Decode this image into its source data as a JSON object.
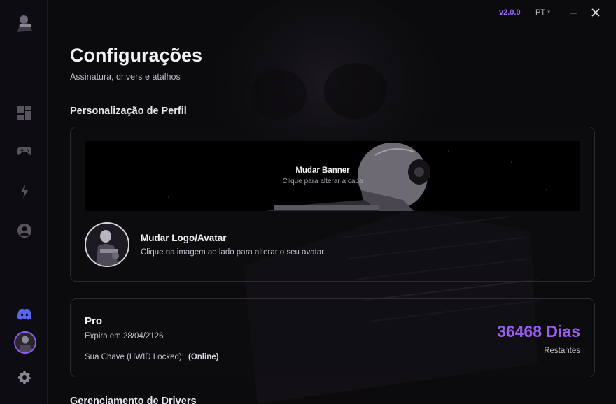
{
  "app": {
    "version": "v2.0.0",
    "language": "PT"
  },
  "colors": {
    "accent": "#9b5cf6",
    "background": "#0b0a0d",
    "discord": "#5865f2"
  },
  "sidebar": {
    "items": [
      {
        "icon": "dashboard-icon"
      },
      {
        "icon": "gamepad-icon"
      },
      {
        "icon": "lightning-icon"
      },
      {
        "icon": "account-circle-icon"
      }
    ],
    "bottom": [
      {
        "icon": "discord-icon"
      },
      {
        "icon": "avatar"
      },
      {
        "icon": "gear-icon"
      }
    ]
  },
  "page": {
    "title": "Configurações",
    "subtitle": "Assinatura, drivers e atalhos"
  },
  "profile": {
    "section_title": "Personalização de Perfil",
    "banner_title": "Mudar Banner",
    "banner_subtitle": "Clique para alterar a capa",
    "avatar_title": "Mudar Logo/Avatar",
    "avatar_subtitle": "Clique na imagem ao lado para alterar o seu avatar."
  },
  "subscription": {
    "plan": "Pro",
    "expiry": "Expira em 28/04/2126",
    "key_label": "Sua Chave (HWID Locked):",
    "key_status": "(Online)",
    "days": "36468 Dias",
    "days_label": "Restantes"
  },
  "drivers": {
    "section_title": "Gerenciamento de Drivers"
  }
}
